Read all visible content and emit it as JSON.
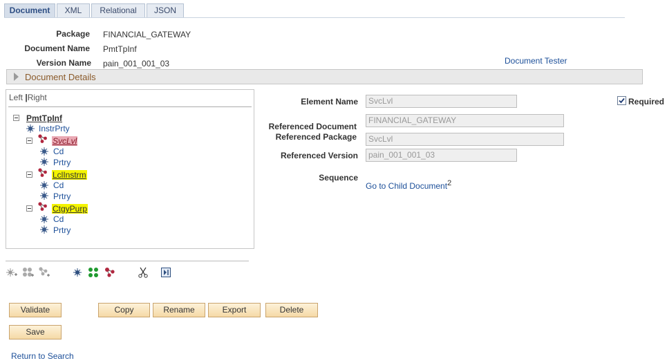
{
  "tabs": [
    "Document",
    "XML",
    "Relational",
    "JSON"
  ],
  "header": {
    "package_label": "Package",
    "package_value": "FINANCIAL_GATEWAY",
    "docname_label": "Document Name",
    "docname_value": "PmtTpInf",
    "version_label": "Version Name",
    "version_value": "pain_001_001_03",
    "tester_link": "Document Tester"
  },
  "details_label": "Document Details",
  "tree": {
    "toggle_left": "Left",
    "toggle_sep": "|",
    "toggle_right": "Right",
    "root": "PmtTpInf",
    "n1": "InstrPrty",
    "n2": "SvcLvl",
    "n2a": "Cd",
    "n2b": "Prtry",
    "n3": "LclInstrm",
    "n3a": "Cd",
    "n3b": "Prtry",
    "n4": "CtgyPurp",
    "n4a": "Cd",
    "n4b": "Prtry"
  },
  "form": {
    "element_label": "Element Name",
    "element_value": "SvcLvl",
    "required_label": "Required",
    "ref_doc_label": "Referenced Document",
    "ref_doc_value": "FINANCIAL_GATEWAY",
    "ref_pkg_label": "Referenced Package",
    "ref_pkg_value": "SvcLvl",
    "ref_ver_label": "Referenced Version",
    "ref_ver_value": "pain_001_001_03",
    "sequence_label": "Sequence",
    "child_link": "Go to Child Document",
    "child_sup": "2"
  },
  "buttons": {
    "validate": "Validate",
    "copy": "Copy",
    "rename": "Rename",
    "export": "Export",
    "delete": "Delete",
    "save": "Save"
  },
  "return_link": "Return to Search",
  "colors": {
    "link": "#1c4f99",
    "selected_group": "#e9a9b4",
    "highlight_group": "#f4f400"
  }
}
